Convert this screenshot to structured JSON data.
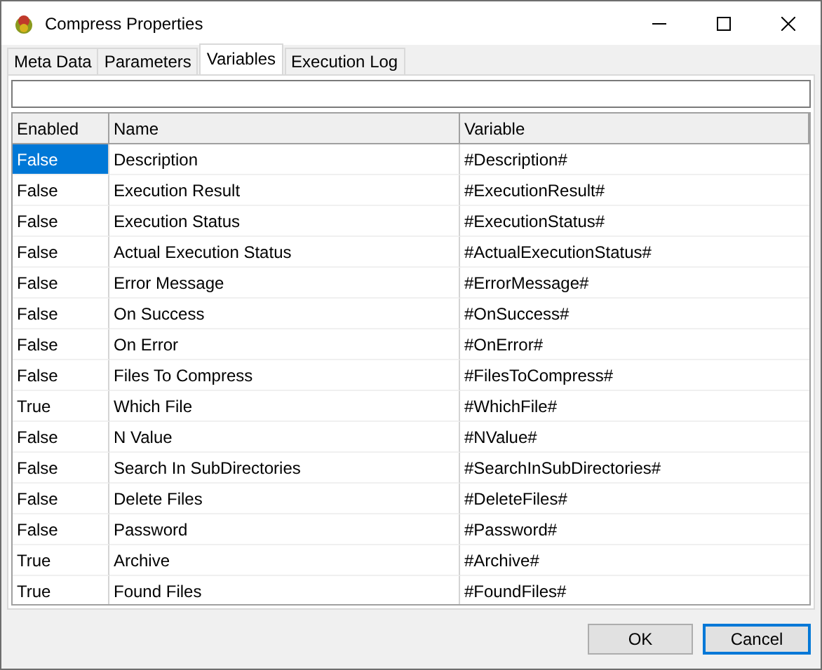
{
  "window": {
    "title": "Compress Properties"
  },
  "tabs": [
    {
      "label": "Meta Data",
      "selected": false
    },
    {
      "label": "Parameters",
      "selected": false
    },
    {
      "label": "Variables",
      "selected": true
    },
    {
      "label": "Execution Log",
      "selected": false
    }
  ],
  "table": {
    "columns": [
      "Enabled",
      "Name",
      "Variable"
    ],
    "rows": [
      {
        "enabled": "False",
        "name": "Description",
        "variable": "#Description#",
        "selected": true
      },
      {
        "enabled": "False",
        "name": "Execution Result",
        "variable": "#ExecutionResult#",
        "selected": false
      },
      {
        "enabled": "False",
        "name": "Execution Status",
        "variable": "#ExecutionStatus#",
        "selected": false
      },
      {
        "enabled": "False",
        "name": "Actual Execution Status",
        "variable": "#ActualExecutionStatus#",
        "selected": false
      },
      {
        "enabled": "False",
        "name": "Error Message",
        "variable": "#ErrorMessage#",
        "selected": false
      },
      {
        "enabled": "False",
        "name": "On Success",
        "variable": "#OnSuccess#",
        "selected": false
      },
      {
        "enabled": "False",
        "name": "On Error",
        "variable": "#OnError#",
        "selected": false
      },
      {
        "enabled": "False",
        "name": "Files To Compress",
        "variable": "#FilesToCompress#",
        "selected": false
      },
      {
        "enabled": "True",
        "name": "Which File",
        "variable": "#WhichFile#",
        "selected": false
      },
      {
        "enabled": "False",
        "name": "N Value",
        "variable": "#NValue#",
        "selected": false
      },
      {
        "enabled": "False",
        "name": "Search In SubDirectories",
        "variable": "#SearchInSubDirectories#",
        "selected": false
      },
      {
        "enabled": "False",
        "name": "Delete Files",
        "variable": "#DeleteFiles#",
        "selected": false
      },
      {
        "enabled": "False",
        "name": "Password",
        "variable": "#Password#",
        "selected": false
      },
      {
        "enabled": "True",
        "name": "Archive",
        "variable": "#Archive#",
        "selected": false
      },
      {
        "enabled": "True",
        "name": "Found Files",
        "variable": "#FoundFiles#",
        "selected": false
      }
    ]
  },
  "buttons": [
    {
      "label": "OK",
      "default": false
    },
    {
      "label": "Cancel",
      "default": true
    }
  ]
}
